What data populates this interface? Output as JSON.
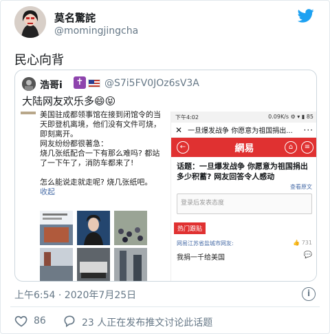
{
  "author": {
    "name": "莫名驚詫",
    "handle": "@momingjingcha"
  },
  "tweet": {
    "text": "民心向背"
  },
  "quoted": {
    "name": "浩哥i",
    "handle": "@S7i5FV0JOz6sV3A",
    "text": "大陆网友欢乐多😄😝",
    "left_text": "美国驻成都领事馆在接到闭馆令的当天即登机离境，他们没有文件可烧，即刻离开。\n网友纷纷都很著急：\n烧几张纸配合一下有那么难吗? 都站了一下午了，消防车都来了!\n\n怎么能说走就走呢? 烧几张纸吧。",
    "fold": "收起",
    "phone": {
      "status_time": "下午4:02",
      "status_right": "0.09K/s ⚙ ▾ ▮ 85",
      "nav_close": "✕",
      "nav_title": "一旦爆发战争 你愿意为祖国捐出...",
      "nav_more": "···",
      "logo": "網易",
      "topic": "话题：一旦爆发战争 你愿意为祖国捐出多少积蓄? 网友回答令人感动",
      "view_original": "查看原文",
      "comment_placeholder": "登录后发表态度",
      "hot_label": "热门跟贴",
      "comment_user": "网易江苏省盐城市网友:",
      "comment_likes": "731",
      "comment_text": "我捐一千给美国"
    }
  },
  "footer": {
    "time": "上午6:54 · 2020年7月25日",
    "likes": "86",
    "discussion": "23 人正在发布推文讨论此话题"
  },
  "colors": {
    "twitter_blue": "#1da1f2",
    "netease_red": "#e03131",
    "secondary_text": "#657786"
  },
  "icons": [
    "twitter-bird-icon",
    "info-icon",
    "heart-icon",
    "reply-bubble-icon"
  ]
}
